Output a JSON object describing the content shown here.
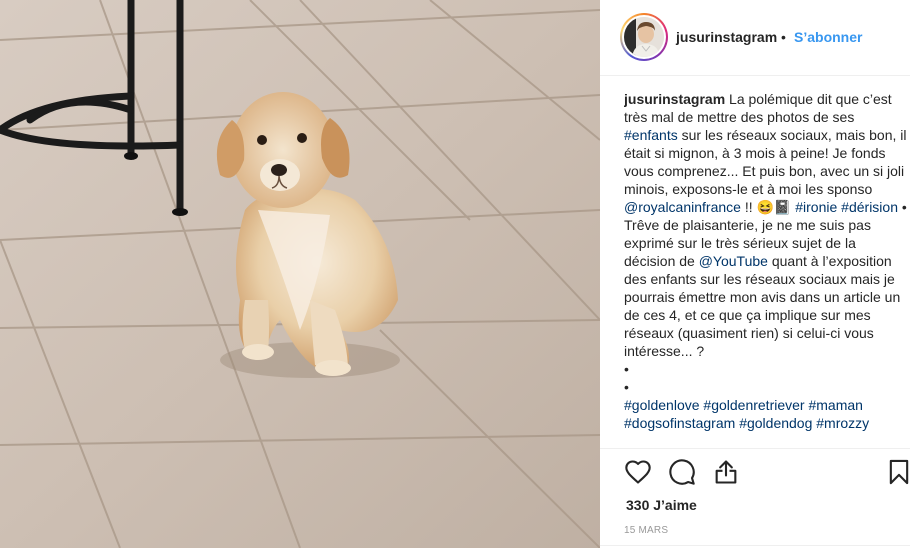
{
  "post": {
    "username": "jusurinstagram",
    "dot": "•",
    "follow_label": "S’abonner",
    "likes": "330 J’aime",
    "date": "15 mars"
  },
  "caption": {
    "username": "jusurinstagram",
    "t1": " La polémique dit que c’est très mal de mettre des photos de ses ",
    "tag_enfants": "#enfants",
    "t2": " sur les réseaux sociaux, mais bon, il était si mignon, à 3 mois à peine! Je fonds vous comprenez... Et puis bon, avec un si joli minois, exposons-le et à moi les sponso ",
    "mention_royal": "@royalcaninfrance",
    "t3": " !! 😆📓 ",
    "tag_ironie": "#ironie",
    "t4": " ",
    "tag_derision": "#dérision",
    "t5": " •",
    "t6": "Trêve de plaisanterie, je ne me suis pas exprimé sur le très sérieux sujet de la décision de ",
    "mention_youtube": "@YouTube",
    "t7": " quant à l’exposition des enfants sur les réseaux sociaux mais je pourrais émettre mon avis dans un article un de ces 4, et ce que ça implique sur mes réseaux (quasiment rien) si celui-ci vous intéresse... ?",
    "bullet1": "•",
    "bullet2": "•",
    "tags_final": [
      "#goldenlove",
      "#goldenretriever",
      "#maman",
      "#dogsofinstagram",
      "#goldendog",
      "#mrozzy"
    ]
  },
  "icons": {
    "like": "heart-icon",
    "comment": "comment-icon",
    "share": "share-icon",
    "save": "bookmark-icon"
  },
  "colors": {
    "link": "#3897f0",
    "hashtag": "#003569",
    "text": "#262626",
    "muted": "#999999"
  }
}
